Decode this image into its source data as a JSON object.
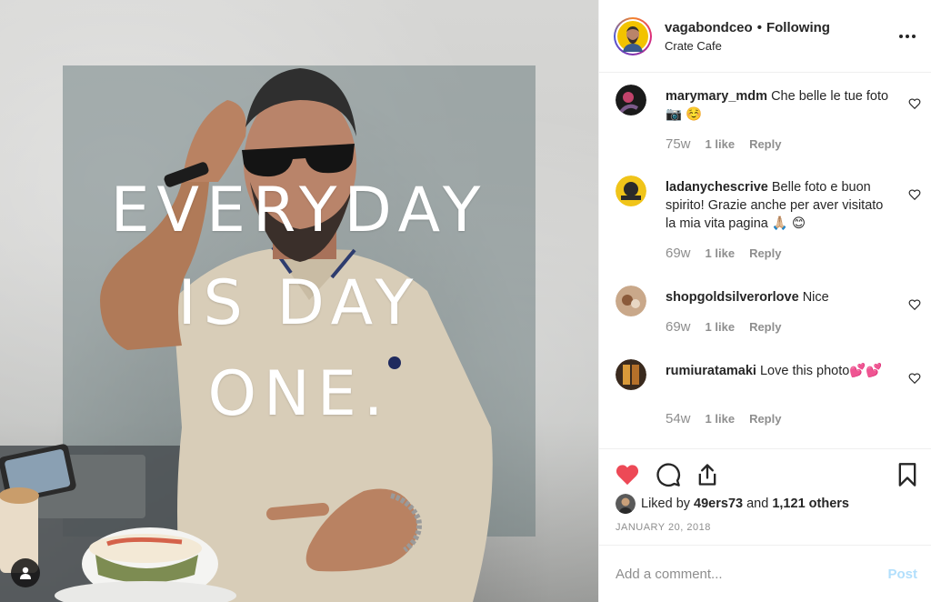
{
  "post": {
    "author": "vagabondceo",
    "separator": "•",
    "follow_status": "Following",
    "location": "Crate Cafe",
    "image_text": [
      "EVERYDAY",
      "IS DAY",
      "ONE."
    ],
    "icons": {
      "more": "more-options-icon",
      "user_tag": "user-tag-icon"
    }
  },
  "comments": [
    {
      "user": "marymary_mdm",
      "text": "Che belle le tue foto📷 ☺️",
      "age": "75w",
      "likes": "1 like",
      "reply": "Reply"
    },
    {
      "user": "ladanychescrive",
      "text": "Belle foto e buon spirito! Grazie anche per aver visitato la mia vita pagina 🙏🏼 😊",
      "age": "69w",
      "likes": "1 like",
      "reply": "Reply"
    },
    {
      "user": "shopgoldsilverorlove",
      "text": "Nice",
      "age": "69w",
      "likes": "1 like",
      "reply": "Reply"
    },
    {
      "user": "rumiuratamaki",
      "text": "Love this photo💕💕",
      "age": "54w",
      "likes": "1 like",
      "reply": "Reply"
    }
  ],
  "actions": {
    "liked_prefix": "Liked by",
    "liked_user": "49ers73",
    "liked_and": "and",
    "liked_others": "1,121 others",
    "date": "JANUARY 20, 2018",
    "liked": true,
    "heart_color": "#ed4956"
  },
  "comment_box": {
    "placeholder": "Add a comment...",
    "post_label": "Post",
    "post_color": "#b2dffc"
  }
}
